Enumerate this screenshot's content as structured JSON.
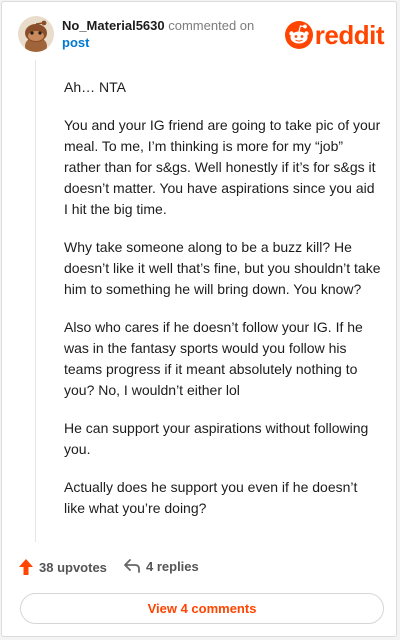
{
  "comment": {
    "author": "No_Material5630",
    "action_text": "commented on",
    "target_link": "post",
    "paragraphs": [
      "Ah… NTA",
      "You and your IG friend are going to take pic of your meal. To me, I’m thinking is more for my “job” rather than for s&gs. Well honestly if it’s for s&gs it doesn’t matter. You have aspirations since you aid I hit the big time.",
      "Why take someone along to be a buzz kill? He doesn’t like it well that’s fine, but you shouldn’t take him to something he will bring down. You know?",
      "Also who cares if he doesn’t follow your IG. If he was in the fantasy sports would you follow his teams progress if it meant absolutely nothing to you? No, I wouldn’t either lol",
      "He can support your aspirations without following you.",
      "Actually does he support you even if he doesn’t like what you’re doing?"
    ]
  },
  "brand": {
    "logo_text": "reddit",
    "color": "#ff4500"
  },
  "footer": {
    "upvotes": "38 upvotes",
    "replies": "4 replies",
    "view_comments": "View 4 comments"
  },
  "icons": {
    "avatar": "snoo-avatar",
    "logo": "reddit-snoo-icon",
    "upvote": "upvote-arrow-icon",
    "reply": "reply-arrow-icon"
  }
}
